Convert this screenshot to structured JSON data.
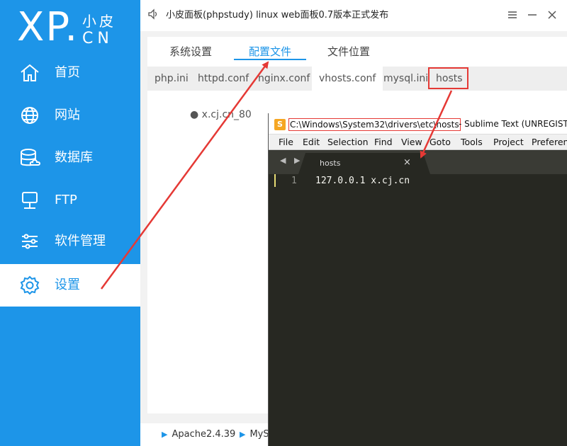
{
  "app": {
    "logo_xp": "XP.",
    "logo_small": "小皮",
    "logo_cn": "CN",
    "window_title": "小皮面板(phpstudy) linux web面板0.7版本正式发布",
    "brand_color": "#1d95e8"
  },
  "sidebar": {
    "items": [
      {
        "label": "首页",
        "icon": "home-icon"
      },
      {
        "label": "网站",
        "icon": "globe-icon"
      },
      {
        "label": "数据库",
        "icon": "database-icon"
      },
      {
        "label": "FTP",
        "icon": "ftp-server-icon"
      },
      {
        "label": "软件管理",
        "icon": "sliders-icon"
      },
      {
        "label": "设置",
        "icon": "gear-icon",
        "active": true
      }
    ]
  },
  "tabs": [
    {
      "label": "系统设置"
    },
    {
      "label": "配置文件",
      "active": true
    },
    {
      "label": "文件位置"
    }
  ],
  "subtabs": [
    {
      "label": "php.ini"
    },
    {
      "label": "httpd.conf"
    },
    {
      "label": "nginx.conf"
    },
    {
      "label": "vhosts.conf",
      "active": true
    },
    {
      "label": "mysql.ini"
    },
    {
      "label": "hosts"
    }
  ],
  "vhost_entry": "● x.cj.cn_80",
  "status": [
    {
      "label": "Apache2.4.39"
    },
    {
      "label": "MyS"
    }
  ],
  "sublime": {
    "icon_letter": "S",
    "path": "C:\\Windows\\System32\\drivers\\etc\\hosts",
    "title_rest": "- Sublime Text (UNREGISTE",
    "menu": [
      "File",
      "Edit",
      "Selection",
      "Find",
      "View",
      "Goto",
      "Tools",
      "Project",
      "Preferen"
    ],
    "nav_arrows": "◀ ▶",
    "tab_name": "hosts",
    "tab_close": "×",
    "line_number": "1",
    "code_line": "127.0.0.1 x.cj.cn"
  },
  "annotation_color": "#e53935"
}
